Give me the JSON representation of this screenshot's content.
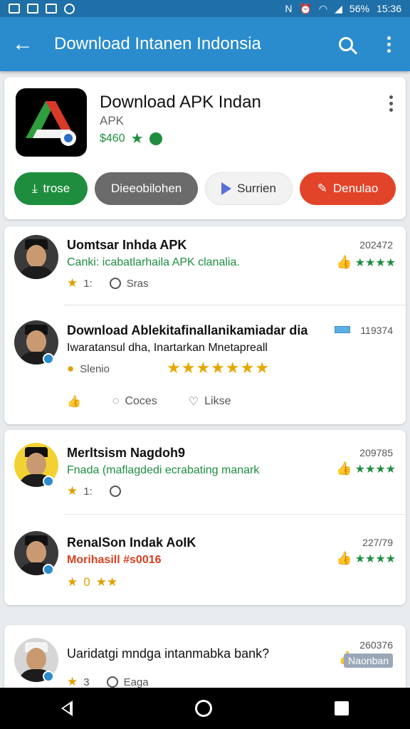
{
  "status_bar": {
    "left_icons": [
      "image-icon",
      "gallery-icon",
      "message-icon",
      "sync-icon"
    ],
    "right_icons": [
      "nfc-icon",
      "alarm-icon",
      "wifi-icon",
      "signal-icon"
    ],
    "battery": "56%",
    "time": "15:36"
  },
  "app_bar": {
    "title": "Download Intanen Indonsia",
    "bg_color": "#2a8ccd"
  },
  "app_card": {
    "name": "Download APK Indan",
    "subtitle": "APK",
    "price": "$460",
    "buttons": [
      {
        "label": "trose",
        "icon": "download-icon",
        "color": "#1e8e3e"
      },
      {
        "label": "Dieeobilohen",
        "color": "#6b6b6b"
      },
      {
        "label": "Surrien",
        "icon": "play-icon",
        "color": "#f2f2f2"
      },
      {
        "label": "Denulao",
        "icon": "pencil-icon",
        "color": "#e2442a"
      }
    ]
  },
  "reviews": [
    {
      "title": "Uomtsar Inhda APK",
      "text": "Canki: icabatlarhaila APK clanalia.",
      "meta_rating": "1:",
      "meta_label": "Sras",
      "count": "202472"
    },
    {
      "title": "Download Ablekitafinallanikamiadar dia",
      "text": "Iwaratansul dha, Inartarkan Mnetapreall",
      "meta_label": "Slenio",
      "count": "119374",
      "star_count": "7",
      "actions": [
        "",
        "Coces",
        "Likse"
      ]
    },
    {
      "title": "Merltsism Nagdoh9",
      "text": "Fnada (maflagdedi ecrabating manark",
      "meta_rating": "1:",
      "count": "209785"
    },
    {
      "title": "RenalSon Indak AoIK",
      "text": "Morihasill #s0016",
      "count": "227/79",
      "star_text": "0"
    },
    {
      "title": "Uaridatgi mndga intanmabka bank?",
      "count": "260376",
      "badge": "Naonban",
      "meta_rating": "3",
      "meta_label": "Eaga"
    }
  ]
}
